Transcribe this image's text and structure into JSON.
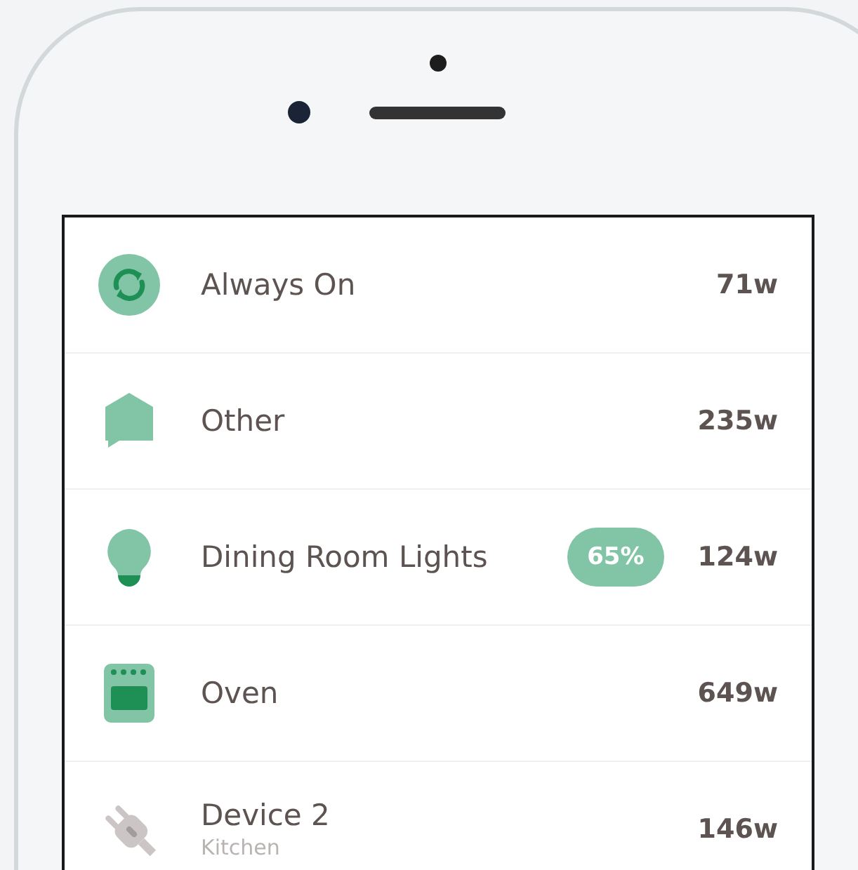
{
  "devices": [
    {
      "kind": "always-on",
      "name": "Always On",
      "watts": "71w"
    },
    {
      "kind": "other",
      "name": "Other",
      "watts": "235w"
    },
    {
      "kind": "light",
      "name": "Dining Room Lights",
      "badge": "65%",
      "watts": "124w"
    },
    {
      "kind": "oven",
      "name": "Oven",
      "watts": "649w"
    },
    {
      "kind": "plug",
      "name": "Device 2",
      "location": "Kitchen",
      "watts": "146w"
    }
  ]
}
